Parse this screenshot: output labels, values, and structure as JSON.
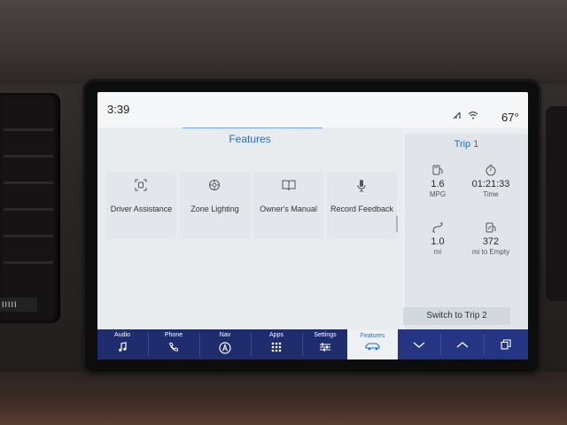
{
  "status": {
    "time": "3:39",
    "temperature": "67°"
  },
  "features": {
    "title": "Features",
    "tiles": [
      {
        "label": "Driver Assistance",
        "icon": "driver-assistance-icon"
      },
      {
        "label": "Zone Lighting",
        "icon": "zone-lighting-icon"
      },
      {
        "label": "Owner's Manual",
        "icon": "book-icon"
      },
      {
        "label": "Record Feedback",
        "icon": "microphone-icon"
      }
    ]
  },
  "trip": {
    "title": "Trip 1",
    "stats": [
      {
        "value": "1.6",
        "unit": "MPG",
        "icon": "fuel-icon"
      },
      {
        "value": "01:21:33",
        "unit": "Time",
        "icon": "stopwatch-icon"
      },
      {
        "value": "1.0",
        "unit": "mi",
        "icon": "distance-icon"
      },
      {
        "value": "372",
        "unit": "mi to Empty",
        "icon": "fuel-range-icon"
      }
    ],
    "switch_label": "Switch to Trip 2"
  },
  "nav": {
    "items": [
      {
        "label": "Audio",
        "icon": "music-note-icon"
      },
      {
        "label": "Phone",
        "icon": "phone-icon"
      },
      {
        "label": "Nav",
        "icon": "navigation-icon"
      },
      {
        "label": "Apps",
        "icon": "apps-grid-icon"
      },
      {
        "label": "Settings",
        "icon": "settings-sliders-icon"
      },
      {
        "label": "Features",
        "icon": "vehicle-icon"
      }
    ],
    "controls": [
      {
        "icon": "chevron-down-icon"
      },
      {
        "icon": "chevron-up-icon"
      },
      {
        "icon": "copy-windows-icon"
      }
    ]
  },
  "colors": {
    "accent": "#1f6fd1",
    "navbar": "#1f2c6e",
    "screen_bg": "#eceff2"
  },
  "vent_label": "IIIII"
}
